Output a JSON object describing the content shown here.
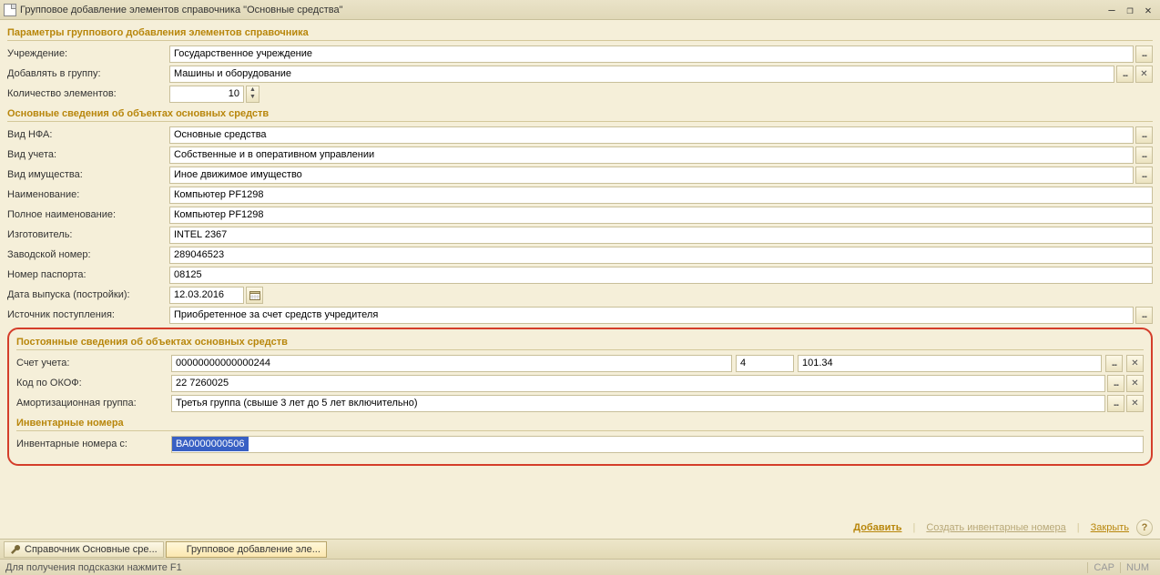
{
  "window": {
    "title": "Групповое добавление элементов справочника \"Основные средства\""
  },
  "sections": {
    "params": "Параметры группового добавления элементов справочника",
    "basic": "Основные сведения об объектах основных средств",
    "permanent": "Постоянные сведения об объектах основных средств",
    "inventory": "Инвентарные номера"
  },
  "labels": {
    "institution": "Учреждение:",
    "add_to_group": "Добавлять в группу:",
    "count": "Количество элементов:",
    "nfa_type": "Вид НФА:",
    "accounting_type": "Вид учета:",
    "property_type": "Вид имущества:",
    "name": "Наименование:",
    "full_name": "Полное наименование:",
    "manufacturer": "Изготовитель:",
    "factory_number": "Заводской номер:",
    "passport_number": "Номер паспорта:",
    "release_date": "Дата выпуска (постройки):",
    "source": "Источник поступления:",
    "account": "Счет учета:",
    "okof": "Код по ОКОФ:",
    "amort_group": "Амортизационная группа:",
    "inv_from": "Инвентарные номера с:"
  },
  "values": {
    "institution": "Государственное учреждение",
    "add_to_group": "Машины и оборудование",
    "count": "10",
    "nfa_type": "Основные средства",
    "accounting_type": "Собственные и в оперативном управлении",
    "property_type": "Иное движимое имущество",
    "name": "Компьютер PF1298",
    "full_name": "Компьютер PF1298",
    "manufacturer": "INTEL 2367",
    "factory_number": "289046523",
    "passport_number": "08125",
    "release_date": "12.03.2016",
    "source": "Приобретенное за счет средств учредителя",
    "account_main": "00000000000000244",
    "account_sub": "4",
    "account_code": "101.34",
    "okof": "22 7260025",
    "amort_group": "Третья группа (свыше 3 лет до 5 лет включительно)",
    "inv_from": "ВА0000000506"
  },
  "buttons": {
    "add": "Добавить",
    "create_inv": "Создать инвентарные номера",
    "close": "Закрыть"
  },
  "taskbar": {
    "ref": "Справочник Основные сре...",
    "group_add": "Групповое добавление эле..."
  },
  "statusbar": {
    "hint": "Для получения подсказки нажмите F1",
    "cap": "CAP",
    "num": "NUM"
  }
}
